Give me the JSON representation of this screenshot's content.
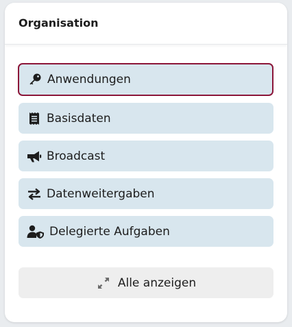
{
  "card": {
    "title": "Organisation"
  },
  "menu": {
    "items": [
      {
        "label": "Anwendungen",
        "icon": "key-icon",
        "active": true
      },
      {
        "label": "Basisdaten",
        "icon": "receipt-icon",
        "active": false
      },
      {
        "label": "Broadcast",
        "icon": "megaphone-icon",
        "active": false
      },
      {
        "label": "Datenweitergaben",
        "icon": "exchange-arrows-icon",
        "active": false
      },
      {
        "label": "Delegierte Aufgaben",
        "icon": "user-shield-icon",
        "active": false
      }
    ]
  },
  "show_all": {
    "label": "Alle anzeigen",
    "icon": "expand-icon"
  },
  "colors": {
    "button_bg": "#d8e6ee",
    "active_border": "#8b1538",
    "show_all_bg": "#eeeeee",
    "icon_color": "#1d1d1d",
    "expand_icon_color": "#6b6b6b"
  }
}
